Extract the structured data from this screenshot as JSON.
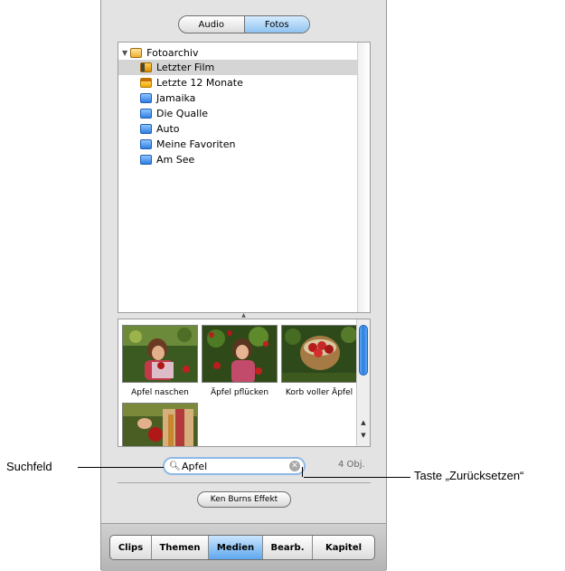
{
  "segmented": {
    "audio": "Audio",
    "photos": "Fotos",
    "active": "Fotos"
  },
  "tree": {
    "root": "Fotoarchiv",
    "items": [
      {
        "label": "Letzter Film",
        "icon": "film-roll-icon",
        "selected": true
      },
      {
        "label": "Letzte 12 Monate",
        "icon": "calendar-icon"
      },
      {
        "label": "Jamaika",
        "icon": "album-folder-icon"
      },
      {
        "label": "Die Qualle",
        "icon": "album-folder-icon"
      },
      {
        "label": "Auto",
        "icon": "album-folder-icon"
      },
      {
        "label": "Meine Favoriten",
        "icon": "album-folder-icon"
      },
      {
        "label": "Am See",
        "icon": "album-folder-icon"
      }
    ]
  },
  "photos": [
    {
      "caption": "Apfel naschen"
    },
    {
      "caption": "Äpfel pflücken"
    },
    {
      "caption": "Korb voller Äpfel"
    },
    {
      "caption": ""
    }
  ],
  "search": {
    "value": "Apfel",
    "count": "4 Obj."
  },
  "ken_burns_label": "Ken Burns Effekt",
  "toolbar": {
    "tabs": [
      "Clips",
      "Themen",
      "Medien",
      "Bearb.",
      "Kapitel"
    ],
    "active": "Medien"
  },
  "callouts": {
    "search_field": "Suchfeld",
    "reset_button": "Taste „Zurücksetzen“"
  },
  "colors": {
    "accent": "#5fa8ee",
    "selection": "#d5d5d5"
  }
}
